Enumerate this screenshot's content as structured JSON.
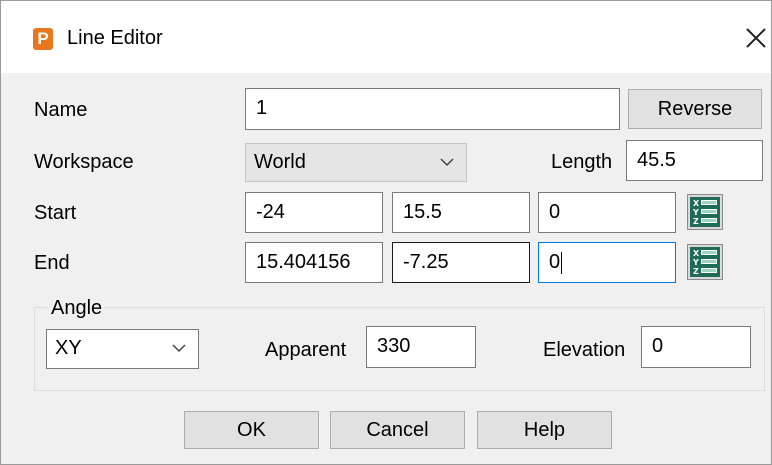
{
  "window": {
    "app_icon_letter": "P",
    "title": "Line Editor",
    "close_glyph": "✕"
  },
  "name": {
    "label": "Name",
    "value": "1"
  },
  "reverse_label": "Reverse",
  "workspace": {
    "label": "Workspace",
    "value": "World"
  },
  "length": {
    "label": "Length",
    "value": "45.5"
  },
  "start": {
    "label": "Start",
    "x": "-24",
    "y": "15.5",
    "z": "0"
  },
  "end": {
    "label": "End",
    "x": "15.404156",
    "y": "-7.25",
    "z": "0"
  },
  "angle": {
    "group_label": "Angle",
    "plane_value": "XY",
    "apparent_label": "Apparent",
    "apparent_value": "330",
    "elevation_label": "Elevation",
    "elevation_value": "0"
  },
  "buttons": {
    "ok": "OK",
    "cancel": "Cancel",
    "help": "Help"
  },
  "icons": {
    "app": "powermill-p-icon",
    "close": "close-icon",
    "dropdown": "chevron-down-icon",
    "xyz": "xyz-position-icon"
  },
  "colors": {
    "app_icon": "#e8771e",
    "focus_border": "#0078d7",
    "dialog_bg": "#f0f0f0"
  }
}
